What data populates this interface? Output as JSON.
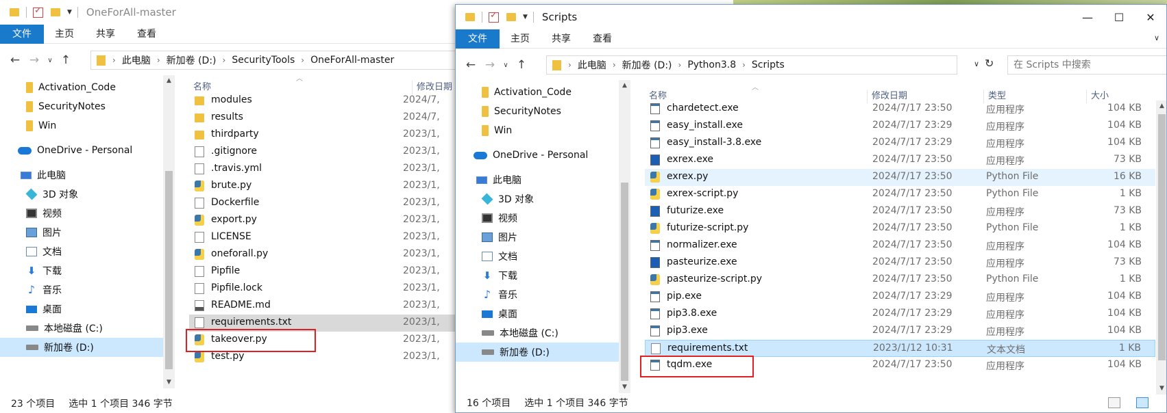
{
  "left_window": {
    "title": "OneForAll-master",
    "ribbon": [
      "文件",
      "主页",
      "共享",
      "查看"
    ],
    "breadcrumb": [
      "此电脑",
      "新加卷 (D:)",
      "SecurityTools",
      "OneForAll-master"
    ],
    "nav_items": [
      {
        "label": "Activation_Code",
        "icon": "folder-icon"
      },
      {
        "label": "SecurityNotes",
        "icon": "folder-icon"
      },
      {
        "label": "Win",
        "icon": "folder-icon"
      },
      {
        "label": "OneDrive - Personal",
        "icon": "onedrive-icon"
      },
      {
        "label": "此电脑",
        "icon": "pc-icon"
      },
      {
        "label": "3D 对象",
        "icon": "cube-icon"
      },
      {
        "label": "视频",
        "icon": "video-icon"
      },
      {
        "label": "图片",
        "icon": "picture-icon"
      },
      {
        "label": "文档",
        "icon": "document-icon"
      },
      {
        "label": "下载",
        "icon": "download-icon"
      },
      {
        "label": "音乐",
        "icon": "music-icon"
      },
      {
        "label": "桌面",
        "icon": "desktop-icon"
      },
      {
        "label": "本地磁盘 (C:)",
        "icon": "drive-icon"
      },
      {
        "label": "新加卷 (D:)",
        "icon": "drive-icon"
      }
    ],
    "columns": {
      "name": "名称",
      "date": "修改日期"
    },
    "files": [
      {
        "name": "modules",
        "date": "2024/7,",
        "icon": "folder"
      },
      {
        "name": "results",
        "date": "2024/7,",
        "icon": "folder"
      },
      {
        "name": "thirdparty",
        "date": "2023/1,",
        "icon": "folder"
      },
      {
        "name": ".gitignore",
        "date": "2023/1,",
        "icon": "txt"
      },
      {
        "name": ".travis.yml",
        "date": "2023/1,",
        "icon": "txt"
      },
      {
        "name": "brute.py",
        "date": "2023/1,",
        "icon": "py"
      },
      {
        "name": "Dockerfile",
        "date": "2023/1,",
        "icon": "txt"
      },
      {
        "name": "export.py",
        "date": "2023/1,",
        "icon": "py"
      },
      {
        "name": "LICENSE",
        "date": "2023/1,",
        "icon": "txt"
      },
      {
        "name": "oneforall.py",
        "date": "2023/1,",
        "icon": "py"
      },
      {
        "name": "Pipfile",
        "date": "2023/1,",
        "icon": "txt"
      },
      {
        "name": "Pipfile.lock",
        "date": "2023/1,",
        "icon": "txt"
      },
      {
        "name": "README.md",
        "date": "2023/1,",
        "icon": "md"
      },
      {
        "name": "requirements.txt",
        "date": "2023/1,",
        "icon": "txt"
      },
      {
        "name": "takeover.py",
        "date": "2023/1,",
        "icon": "py"
      },
      {
        "name": "test.py",
        "date": "2023/1,",
        "icon": "py"
      }
    ],
    "status": {
      "count": "23 个项目",
      "selection": "选中 1 个项目  346 字节"
    }
  },
  "right_window": {
    "title": "Scripts",
    "ribbon": [
      "文件",
      "主页",
      "共享",
      "查看"
    ],
    "breadcrumb": [
      "此电脑",
      "新加卷 (D:)",
      "Python3.8",
      "Scripts"
    ],
    "search_placeholder": "在 Scripts 中搜索",
    "nav_items": [
      {
        "label": "Activation_Code",
        "icon": "folder-icon"
      },
      {
        "label": "SecurityNotes",
        "icon": "folder-icon"
      },
      {
        "label": "Win",
        "icon": "folder-icon"
      },
      {
        "label": "OneDrive - Personal",
        "icon": "onedrive-icon"
      },
      {
        "label": "此电脑",
        "icon": "pc-icon"
      },
      {
        "label": "3D 对象",
        "icon": "cube-icon"
      },
      {
        "label": "视频",
        "icon": "video-icon"
      },
      {
        "label": "图片",
        "icon": "picture-icon"
      },
      {
        "label": "文档",
        "icon": "document-icon"
      },
      {
        "label": "下载",
        "icon": "download-icon"
      },
      {
        "label": "音乐",
        "icon": "music-icon"
      },
      {
        "label": "桌面",
        "icon": "desktop-icon"
      },
      {
        "label": "本地磁盘 (C:)",
        "icon": "drive-icon"
      },
      {
        "label": "新加卷 (D:)",
        "icon": "drive-icon"
      }
    ],
    "columns": {
      "name": "名称",
      "date": "修改日期",
      "type": "类型",
      "size": "大小"
    },
    "files": [
      {
        "name": "chardetect.exe",
        "date": "2024/7/17 23:50",
        "type": "应用程序",
        "size": "104 KB",
        "icon": "exe"
      },
      {
        "name": "easy_install.exe",
        "date": "2024/7/17 23:29",
        "type": "应用程序",
        "size": "104 KB",
        "icon": "exe"
      },
      {
        "name": "easy_install-3.8.exe",
        "date": "2024/7/17 23:29",
        "type": "应用程序",
        "size": "104 KB",
        "icon": "exe"
      },
      {
        "name": "exrex.exe",
        "date": "2024/7/17 23:50",
        "type": "应用程序",
        "size": "73 KB",
        "icon": "exe2"
      },
      {
        "name": "exrex.py",
        "date": "2024/7/17 23:50",
        "type": "Python File",
        "size": "16 KB",
        "icon": "py"
      },
      {
        "name": "exrex-script.py",
        "date": "2024/7/17 23:50",
        "type": "Python File",
        "size": "1 KB",
        "icon": "py"
      },
      {
        "name": "futurize.exe",
        "date": "2024/7/17 23:50",
        "type": "应用程序",
        "size": "73 KB",
        "icon": "exe2"
      },
      {
        "name": "futurize-script.py",
        "date": "2024/7/17 23:50",
        "type": "Python File",
        "size": "1 KB",
        "icon": "py"
      },
      {
        "name": "normalizer.exe",
        "date": "2024/7/17 23:50",
        "type": "应用程序",
        "size": "104 KB",
        "icon": "exe"
      },
      {
        "name": "pasteurize.exe",
        "date": "2024/7/17 23:50",
        "type": "应用程序",
        "size": "73 KB",
        "icon": "exe2"
      },
      {
        "name": "pasteurize-script.py",
        "date": "2024/7/17 23:50",
        "type": "Python File",
        "size": "1 KB",
        "icon": "py"
      },
      {
        "name": "pip.exe",
        "date": "2024/7/17 23:29",
        "type": "应用程序",
        "size": "104 KB",
        "icon": "exe"
      },
      {
        "name": "pip3.8.exe",
        "date": "2024/7/17 23:29",
        "type": "应用程序",
        "size": "104 KB",
        "icon": "exe"
      },
      {
        "name": "pip3.exe",
        "date": "2024/7/17 23:29",
        "type": "应用程序",
        "size": "104 KB",
        "icon": "exe"
      },
      {
        "name": "requirements.txt",
        "date": "2023/1/12 10:31",
        "type": "文本文档",
        "size": "1 KB",
        "icon": "txt"
      },
      {
        "name": "tqdm.exe",
        "date": "2024/7/17 23:50",
        "type": "应用程序",
        "size": "104 KB",
        "icon": "exe"
      }
    ],
    "status": {
      "count": "16 个项目",
      "selection": "选中 1 个项目  346 字节"
    }
  }
}
